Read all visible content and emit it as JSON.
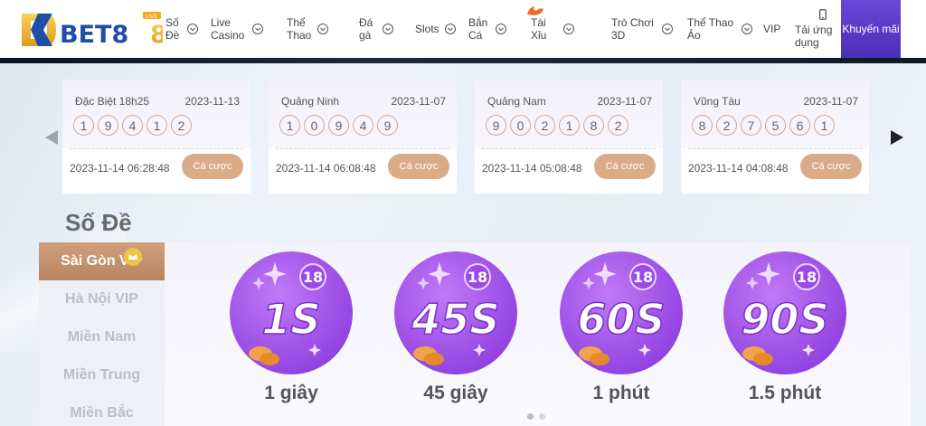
{
  "brand": {
    "logo_text": "BET8",
    "logo_badge": "LIVE"
  },
  "nav": {
    "items": [
      {
        "label": "Số Đề",
        "chevron": true
      },
      {
        "label": "Live Casino",
        "chevron": true
      },
      {
        "label": "Thể Thao",
        "chevron": true
      },
      {
        "label": "Đá gà",
        "chevron": true
      },
      {
        "label": "Slots",
        "chevron": true
      },
      {
        "label": "Bắn Cá",
        "chevron": true
      },
      {
        "label": "Tài Xỉu",
        "chevron": true,
        "badge": "hot"
      },
      {
        "label": "Trò Chơi 3D",
        "chevron": true
      },
      {
        "label": "Thể Thao Ảo",
        "chevron": true
      },
      {
        "label": "VIP",
        "chevron": false
      },
      {
        "label": "Tải ứng dụng",
        "chevron": false,
        "icon": "phone-icon"
      }
    ],
    "promo_label": "Khuyến mãi"
  },
  "results": [
    {
      "name": "Đặc Biệt 18h25",
      "date": "2023-11-13",
      "numbers": [
        "1",
        "9",
        "4",
        "1",
        "2"
      ],
      "time": "2023-11-14 06:28:48",
      "bet_label": "Cá cược"
    },
    {
      "name": "Quảng Ninh",
      "date": "2023-11-07",
      "numbers": [
        "1",
        "0",
        "9",
        "4",
        "9"
      ],
      "time": "2023-11-14 06:08:48",
      "bet_label": "Cá cược"
    },
    {
      "name": "Quảng Nam",
      "date": "2023-11-07",
      "numbers": [
        "9",
        "0",
        "2",
        "1",
        "8",
        "2"
      ],
      "time": "2023-11-14 05:08:48",
      "bet_label": "Cá cược"
    },
    {
      "name": "Vũng Tàu",
      "date": "2023-11-07",
      "numbers": [
        "8",
        "2",
        "7",
        "5",
        "6",
        "1"
      ],
      "time": "2023-11-14 04:08:48",
      "bet_label": "Cá cược"
    }
  ],
  "section": {
    "title": "Số Đề",
    "regions": [
      "Sài Gòn VIP",
      "Hà Nội VIP",
      "Miền Nam",
      "Miền Trung",
      "Miền Bắc"
    ],
    "active_region": "Sài Gòn VIP",
    "games": [
      {
        "badge": "1S",
        "label": "1 giây"
      },
      {
        "badge": "45S",
        "label": "45 giây"
      },
      {
        "badge": "60S",
        "label": "1 phút"
      },
      {
        "badge": "90S",
        "label": "1.5 phút"
      }
    ]
  },
  "colors": {
    "accent": "#d9ab89",
    "promo": "#5a3bc8",
    "game_circle": "#a457ea"
  }
}
